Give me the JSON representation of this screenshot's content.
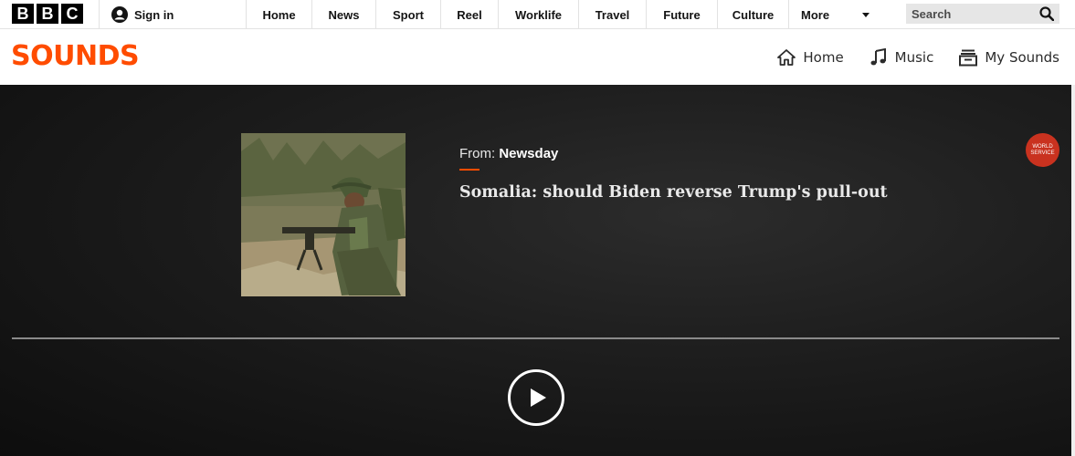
{
  "bbc_nav": {
    "logo_letters": [
      "B",
      "B",
      "C"
    ],
    "signin_label": "Sign in",
    "items": [
      {
        "label": "Home"
      },
      {
        "label": "News"
      },
      {
        "label": "Sport"
      },
      {
        "label": "Reel"
      },
      {
        "label": "Worklife"
      },
      {
        "label": "Travel"
      },
      {
        "label": "Future"
      },
      {
        "label": "Culture"
      },
      {
        "label": "More"
      }
    ],
    "search": {
      "placeholder": "Search",
      "icon": "search-icon"
    }
  },
  "sounds_header": {
    "logo": "SOUNDS",
    "nav": [
      {
        "label": "Home",
        "icon": "home-icon"
      },
      {
        "label": "Music",
        "icon": "music-note-icon"
      },
      {
        "label": "My Sounds",
        "icon": "my-sounds-icon"
      }
    ]
  },
  "player": {
    "from_prefix": "From:",
    "brand": "Newsday",
    "episode_title": "Somalia: should Biden reverse Trump's pull-out",
    "badge_line1": "WORLD",
    "badge_line2": "SERVICE",
    "progress": 0
  },
  "colors": {
    "accent": "#ff4c00",
    "badge": "#c9321f",
    "player_bg": "#1a1a1a"
  }
}
